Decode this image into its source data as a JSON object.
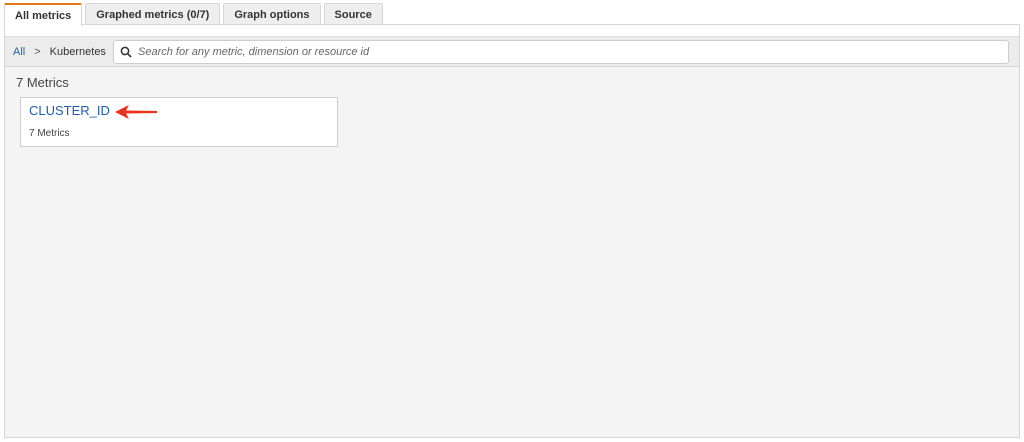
{
  "tabs": [
    {
      "label": "All metrics"
    },
    {
      "label": "Graphed metrics (0/7)"
    },
    {
      "label": "Graph options"
    },
    {
      "label": "Source"
    }
  ],
  "breadcrumb": {
    "root": "All",
    "separator": ">",
    "current": "Kubernetes"
  },
  "search": {
    "placeholder": "Search for any metric, dimension or resource id"
  },
  "results": {
    "count_label": "7 Metrics",
    "cards": [
      {
        "title": "CLUSTER_ID",
        "subtitle": "7 Metrics"
      }
    ]
  },
  "colors": {
    "accent": "#e47911",
    "link": "#1f5fb0",
    "annotation_arrow": "#e8321e"
  }
}
